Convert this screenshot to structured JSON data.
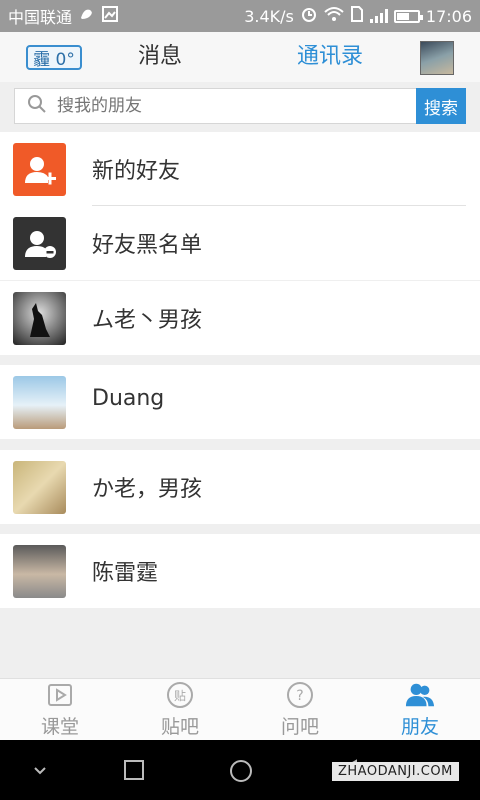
{
  "status_bar": {
    "carrier": "中国联通",
    "speed": "3.4K/s",
    "network_type": "G",
    "time": "17:06",
    "battery_level": 0.6
  },
  "header": {
    "weather": "霾 0°",
    "tab_messages": "消息",
    "tab_contacts": "通讯录"
  },
  "search": {
    "placeholder": "搜我的朋友",
    "button_label": "搜索"
  },
  "list": {
    "new_friends": "新的好友",
    "blacklist": "好友黑名单",
    "contacts": [
      {
        "name": "ム老丶男孩"
      },
      {
        "name": "Duang"
      },
      {
        "name": "か老，男孩"
      },
      {
        "name": "陈雷霆"
      }
    ]
  },
  "bottom_nav": {
    "items": [
      {
        "label": "课堂"
      },
      {
        "label": "贴吧"
      },
      {
        "label": "问吧"
      },
      {
        "label": "朋友"
      }
    ],
    "active_index": 3
  },
  "watermark": "ZHAODANJI.COM",
  "colors": {
    "accent": "#2e8fd6",
    "new_friends_icon": "#f05a28",
    "blacklist_icon": "#333333"
  }
}
